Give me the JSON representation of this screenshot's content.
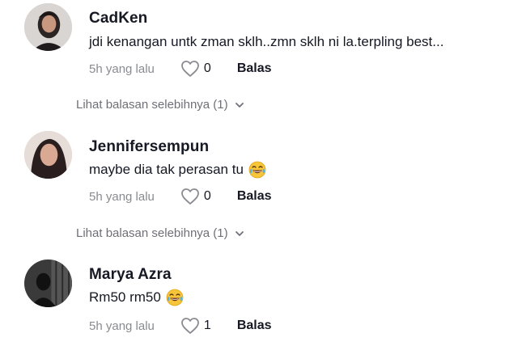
{
  "comments": [
    {
      "username": "CadKen",
      "text": "jdi kenangan untk zman sklh..zmn sklh ni la.terpling best...",
      "time": "5h yang lalu",
      "likes": "0",
      "reply_label": "Balas",
      "more_replies": "Lihat balasan selebihnya (1)",
      "avatar": "avatar-woman-photo",
      "emoji": ""
    },
    {
      "username": "Jennifersempun",
      "text": "maybe dia tak perasan tu",
      "time": "5h yang lalu",
      "likes": "0",
      "reply_label": "Balas",
      "more_replies": "Lihat balasan selebihnya (1)",
      "avatar": "avatar-woman-photo",
      "emoji": "face-with-tears-of-joy"
    },
    {
      "username": "Marya Azra",
      "text": "Rm50 rm50",
      "time": "5h yang lalu",
      "likes": "1",
      "reply_label": "Balas",
      "avatar": "avatar-dark-photo",
      "emoji": "face-with-tears-of-joy"
    }
  ],
  "colors": {
    "text": "#161823",
    "muted": "#8a8b91",
    "more": "#6f7077",
    "background": "#ffffff"
  },
  "icons": {
    "like": "heart-outline-icon",
    "expand": "chevron-down-icon"
  }
}
